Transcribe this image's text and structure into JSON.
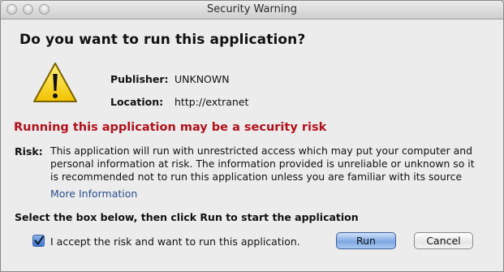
{
  "window": {
    "title": "Security Warning"
  },
  "dialog": {
    "question": "Do you want to run this application?",
    "publisher_label": "Publisher:",
    "publisher_value": "UNKNOWN",
    "location_label": "Location:",
    "location_value": "http://extranet",
    "risk_heading": "Running this application may be a security risk",
    "risk_label": "Risk:",
    "risk_lines": [
      "This application will run with unrestricted access which may put your computer and",
      "personal information at risk. The information provided is unreliable or unknown so it",
      "is recommended not to run this application unless you are familiar with its source"
    ],
    "more_info": "More Information",
    "instruction": "Select the box below, then click Run to start the application",
    "accept_label": "I accept the risk and want to run this application.",
    "accept_checked": true
  },
  "buttons": {
    "run": "Run",
    "cancel": "Cancel"
  },
  "icons": {
    "warning": "warning-triangle-icon",
    "checkbox_check": "checkmark-icon"
  },
  "colors": {
    "risk_heading": "#b4101a",
    "link": "#2a4e8c",
    "default_button": "#7fa8e2"
  }
}
